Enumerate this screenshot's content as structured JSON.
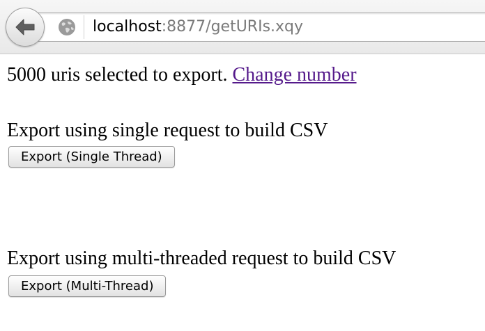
{
  "browser": {
    "url_host": "localhost",
    "url_rest": ":8877/getURIs.xqy",
    "back_icon": "arrow-left-icon",
    "site_icon": "globe-icon"
  },
  "page": {
    "uris_selected_text": "5000 uris selected to export.",
    "change_number_link": "Change number",
    "single_heading": "Export using single request to build CSV",
    "single_button": "Export (Single Thread)",
    "multi_heading": "Export using multi-threaded request to build CSV",
    "multi_button": "Export (Multi-Thread)",
    "link_color": "#551a8b"
  }
}
